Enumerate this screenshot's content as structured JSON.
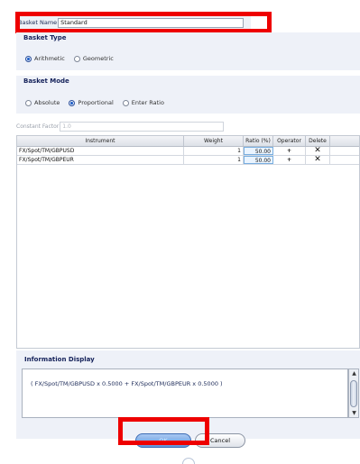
{
  "basket": {
    "name_label": "Basket Name",
    "name_value": "Standard"
  },
  "basket_type": {
    "heading": "Basket Type",
    "options": [
      {
        "label": "Arithmetic",
        "selected": true
      },
      {
        "label": "Geometric",
        "selected": false
      }
    ]
  },
  "basket_mode": {
    "heading": "Basket Mode",
    "options": [
      {
        "label": "Absolute",
        "selected": false
      },
      {
        "label": "Proportional",
        "selected": true
      },
      {
        "label": "Enter Ratio",
        "selected": false
      }
    ]
  },
  "constant_factor": {
    "label": "Constant Factor",
    "value": "1.0"
  },
  "table": {
    "headers": [
      "Instrument",
      "Weight",
      "Ratio (%)",
      "Operator",
      "Delete"
    ],
    "rows": [
      {
        "instrument": "FX/Spot/TM/GBPUSD",
        "weight": "1",
        "ratio": "50.00",
        "operator": "+",
        "delete": "✕"
      },
      {
        "instrument": "FX/Spot/TM/GBPEUR",
        "weight": "1",
        "ratio": "50.00",
        "operator": "+",
        "delete": "✕"
      }
    ]
  },
  "info_display": {
    "heading": "Information Display",
    "text": "( FX/Spot/TM/GBPUSD  x 0.5000   +   FX/Spot/TM/GBPEUR  x 0.5000  )"
  },
  "buttons": {
    "ok": "OK",
    "cancel": "Cancel"
  },
  "colors": {
    "highlight": "#ee0000",
    "section_heading": "#15225a",
    "radio_selected": "#1f5fc8"
  }
}
